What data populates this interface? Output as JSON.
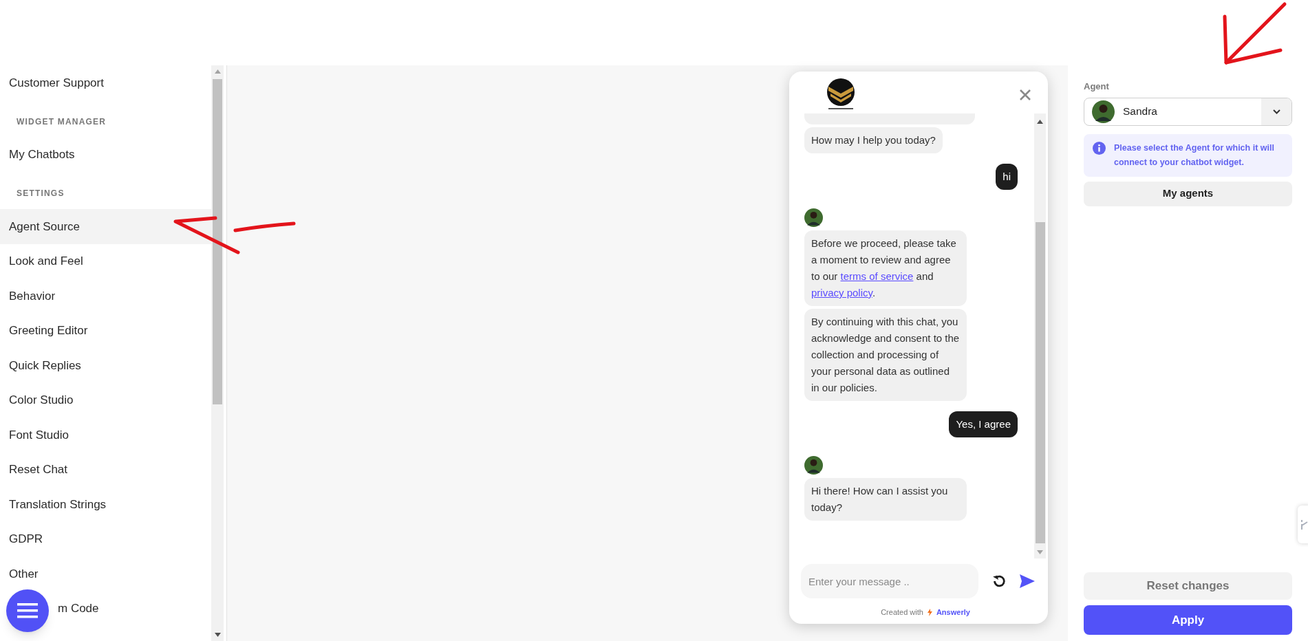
{
  "sidebar": {
    "items": [
      {
        "kind": "item",
        "label": "Customer Support",
        "selected": false
      },
      {
        "kind": "header",
        "label": "WIDGET MANAGER"
      },
      {
        "kind": "item",
        "label": "My Chatbots",
        "selected": false
      },
      {
        "kind": "header",
        "label": "SETTINGS"
      },
      {
        "kind": "item",
        "label": "Agent Source",
        "selected": true
      },
      {
        "kind": "item",
        "label": "Look and Feel",
        "selected": false
      },
      {
        "kind": "item",
        "label": "Behavior",
        "selected": false
      },
      {
        "kind": "item",
        "label": "Greeting Editor",
        "selected": false
      },
      {
        "kind": "item",
        "label": "Quick Replies",
        "selected": false
      },
      {
        "kind": "item",
        "label": "Color Studio",
        "selected": false
      },
      {
        "kind": "item",
        "label": "Font Studio",
        "selected": false
      },
      {
        "kind": "item",
        "label": "Reset Chat",
        "selected": false
      },
      {
        "kind": "item",
        "label": "Translation Strings",
        "selected": false
      },
      {
        "kind": "item",
        "label": "GDPR",
        "selected": false
      },
      {
        "kind": "item",
        "label": "Other",
        "selected": false
      },
      {
        "kind": "covered",
        "label": "m Code",
        "selected": false
      }
    ]
  },
  "chat": {
    "messages": [
      {
        "kind": "partial",
        "avatar": false
      },
      {
        "kind": "bot",
        "avatar": false,
        "parts": [
          {
            "text": "How may I help you today?"
          }
        ]
      },
      {
        "kind": "user",
        "avatar": false,
        "parts": [
          {
            "text": "hi"
          }
        ]
      },
      {
        "kind": "bot",
        "avatar": true,
        "parts": [
          {
            "text": "Before we proceed, please take a moment to review and agree to our "
          },
          {
            "link": "terms of service"
          },
          {
            "text": " and "
          },
          {
            "link": "privacy policy"
          },
          {
            "text": "."
          }
        ]
      },
      {
        "kind": "bot",
        "avatar": false,
        "parts": [
          {
            "text": "By continuing with this chat, you acknowledge and consent to the collection and processing of your personal data as outlined in our policies."
          }
        ]
      },
      {
        "kind": "user",
        "avatar": false,
        "parts": [
          {
            "text": "Yes, I agree"
          }
        ]
      },
      {
        "kind": "bot",
        "avatar": true,
        "parts": [
          {
            "text": "Hi there! How can I assist you today?"
          }
        ]
      }
    ],
    "input": {
      "placeholder": "Enter your message .."
    },
    "footer": {
      "prefix": "Created with",
      "brand": "Answerly"
    }
  },
  "agent_panel": {
    "label": "Agent",
    "select": {
      "value": "Sandra"
    },
    "info": "Please select the Agent for which it will connect to your chatbot widget.",
    "my_agents_button": "My agents",
    "buttons": [
      {
        "kind": "reset",
        "label": "Reset changes"
      },
      {
        "kind": "primary",
        "label": "Apply"
      }
    ]
  }
}
